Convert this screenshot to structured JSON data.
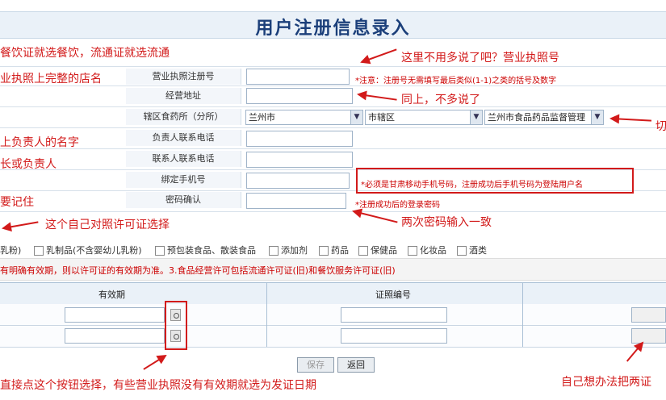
{
  "page": {
    "title": "用户注册信息录入"
  },
  "form": {
    "license_no_label": "营业执照注册号",
    "license_no_note": "*注意：注册号无需填写最后类似(1-1)之类的括号及数字",
    "address_label": "经营地址",
    "district_label": "辖区食药所（分所）",
    "district_select_1": "兰州市",
    "district_select_2": "市辖区",
    "district_select_3": "兰州市食品药品监督管理",
    "contact_person_phone_label": "负责人联系电话",
    "contact_phone_label": "联系人联系电话",
    "bind_mobile_label": "绑定手机号",
    "bind_mobile_note": "*必须是甘肃移动手机号码，注册成功后手机号码为登陆用户名",
    "password_confirm_label": "密码确认",
    "password_note": "*注册成功后的登录密码"
  },
  "categories": {
    "items": [
      "乳粉)",
      "乳制品(不含婴幼儿乳粉)",
      "预包装食品、散装食品",
      "添加剂",
      "药品",
      "保健品",
      "化妆品",
      "酒类"
    ]
  },
  "warning_text": "有明确有效期，则以许可证的有效期为准。3.食品经营许可包括流通许可证(旧)和餐饮服务许可证(旧)",
  "table": {
    "col_validity": "有效期",
    "col_cert_no": "证照编号"
  },
  "buttons": {
    "save": "保存",
    "back": "返回"
  },
  "annotations": {
    "a1": "餐饮证就选餐饮，流通证就选流通",
    "a2": "这里不用多说了吧？营业执照号",
    "a3": "业执照上完整的店名",
    "a4": "同上，不多说了",
    "a5": "切",
    "a6": "上负责人的名字",
    "a7": "长或负责人",
    "a8": "要记住",
    "a9": "这个自己对照许可证选择",
    "a10": "两次密码输入一致",
    "a11": "直接点这个按钮选择，有些营业执照没有有效期就选为发证日期",
    "a12": "自己想办法把两证"
  },
  "colors": {
    "title": "#1b3f7a",
    "annotation": "#d21a1a",
    "note": "#cc0000"
  }
}
